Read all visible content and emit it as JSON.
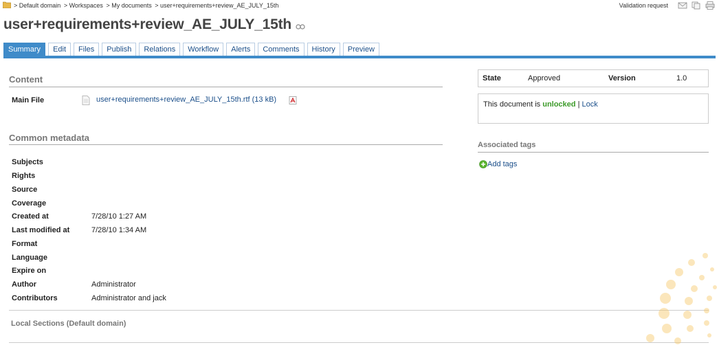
{
  "topbar": {
    "breadcrumb": [
      "> Default domain",
      "> Workspaces",
      "> My documents",
      "> user+requirements+review_AE_JULY_15th"
    ],
    "validation_request": "Validation request",
    "icons": [
      "mail-icon",
      "copy-icon",
      "print-icon"
    ]
  },
  "document": {
    "title": "user+requirements+review_AE_JULY_15th"
  },
  "tabs": [
    "Summary",
    "Edit",
    "Files",
    "Publish",
    "Relations",
    "Workflow",
    "Alerts",
    "Comments",
    "History",
    "Preview"
  ],
  "content": {
    "heading": "Content",
    "main_file_label": "Main File",
    "main_file_link": "user+requirements+review_AE_JULY_15th.rtf (13 kB)"
  },
  "metadata": {
    "heading": "Common metadata",
    "fields": [
      {
        "label": "Subjects",
        "value": ""
      },
      {
        "label": "Rights",
        "value": ""
      },
      {
        "label": "Source",
        "value": ""
      },
      {
        "label": "Coverage",
        "value": ""
      },
      {
        "label": "Created at",
        "value": "7/28/10 1:27 AM"
      },
      {
        "label": "Last modified at",
        "value": "7/28/10 1:34 AM"
      },
      {
        "label": "Format",
        "value": ""
      },
      {
        "label": "Language",
        "value": ""
      },
      {
        "label": "Expire on",
        "value": ""
      },
      {
        "label": "Author",
        "value": "Administrator"
      },
      {
        "label": "Contributors",
        "value": "Administrator and jack"
      }
    ]
  },
  "local_sections": {
    "heading": "Local Sections (Default domain)"
  },
  "status": {
    "state_label": "State",
    "state_value": "Approved",
    "version_label": "Version",
    "version_value": "1.0",
    "lock_prefix": "This document is",
    "lock_state": "unlocked",
    "separator": "|",
    "lock_action": "Lock"
  },
  "tags": {
    "heading": "Associated tags",
    "add_label": "Add tags"
  },
  "colors": {
    "accent": "#3f8bc9",
    "link": "#1b4f8a",
    "unlocked": "#3c9a29"
  }
}
